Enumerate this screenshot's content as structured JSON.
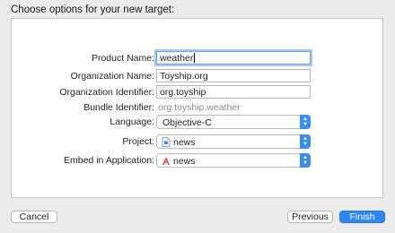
{
  "header": {
    "title": "Choose options for your new target:"
  },
  "form": {
    "product_name": {
      "label": "Product Name:",
      "value": "weather"
    },
    "organization_name": {
      "label": "Organization Name:",
      "value": "Toyship.org"
    },
    "organization_identifier": {
      "label": "Organization Identifier:",
      "value": "org.toyship"
    },
    "bundle_identifier": {
      "label": "Bundle Identifier:",
      "value": "org.toyship.weather"
    },
    "language": {
      "label": "Language:",
      "value": "Objective-C"
    },
    "project": {
      "label": "Project:",
      "value": "news",
      "icon": "project-file-icon"
    },
    "embed": {
      "label": "Embed in Application:",
      "value": "news",
      "icon": "app-target-icon"
    }
  },
  "footer": {
    "cancel_label": "Cancel",
    "previous_label": "Previous",
    "finish_label": "Finish"
  },
  "colors": {
    "accent": "#2f86f6",
    "focus_ring": "#a7c8f2"
  }
}
